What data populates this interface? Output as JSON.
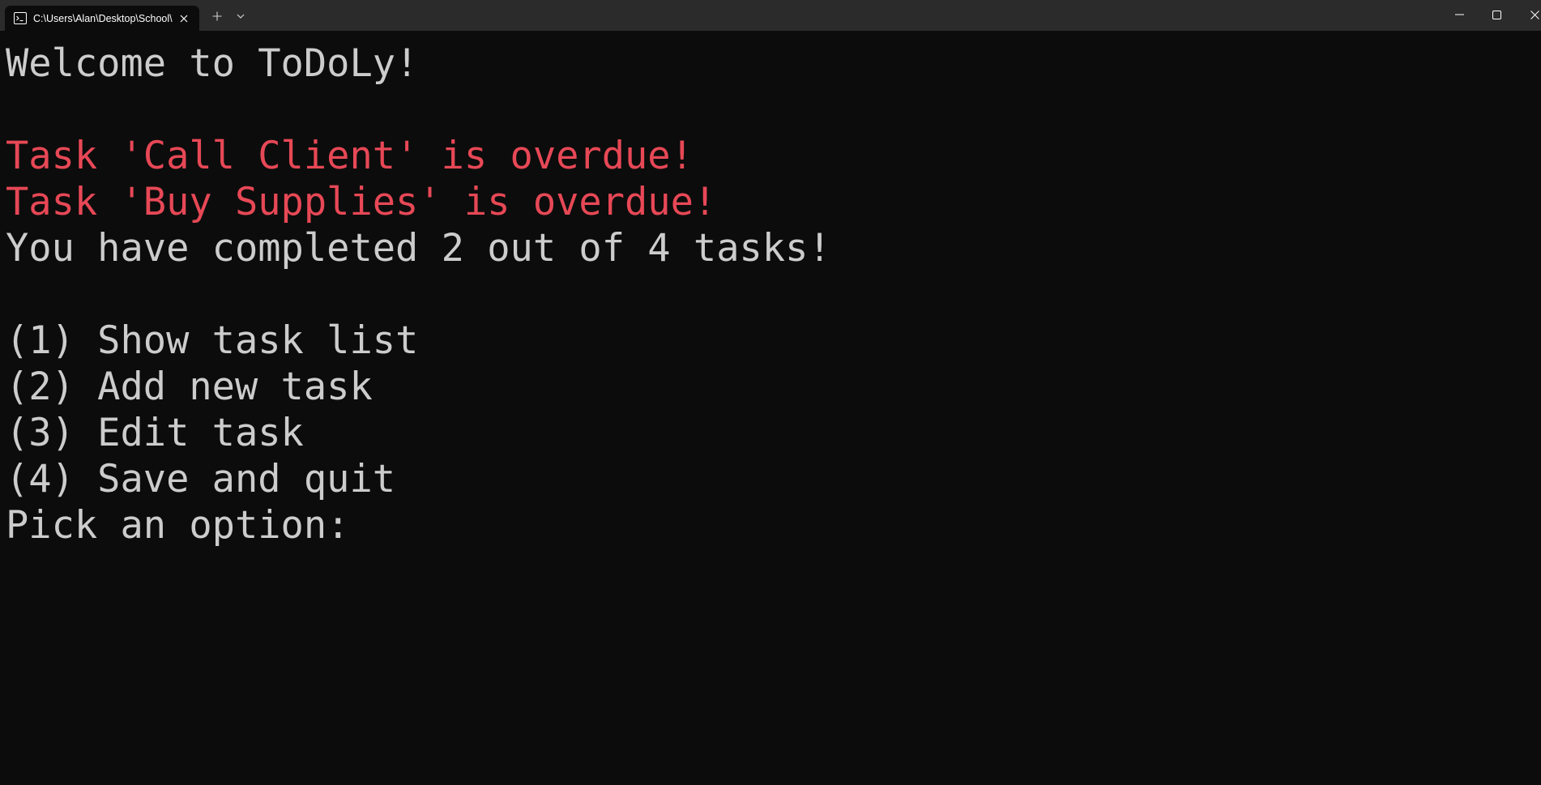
{
  "titlebar": {
    "tab_title": "C:\\Users\\Alan\\Desktop\\School\\ToDoLy\\ToDoLy.exe",
    "icons": {
      "tab": "terminal-icon",
      "close_tab": "close-icon",
      "new_tab": "plus-icon",
      "dropdown": "chevron-down-icon",
      "minimize": "minimize-icon",
      "maximize": "maximize-icon",
      "close_window": "close-icon"
    }
  },
  "console": {
    "welcome": "Welcome to ToDoLy!",
    "overdue": [
      "Task 'Call Client' is overdue!",
      "Task 'Buy Supplies' is overdue!"
    ],
    "progress": "You have completed 2 out of 4 tasks!",
    "menu": [
      "(1) Show task list",
      "(2) Add new task",
      "(3) Edit task",
      "(4) Save and quit"
    ],
    "prompt": "Pick an option:"
  },
  "colors": {
    "background": "#0c0c0c",
    "titlebar": "#2b2b2b",
    "text": "#cccccc",
    "overdue": "#e74856"
  }
}
